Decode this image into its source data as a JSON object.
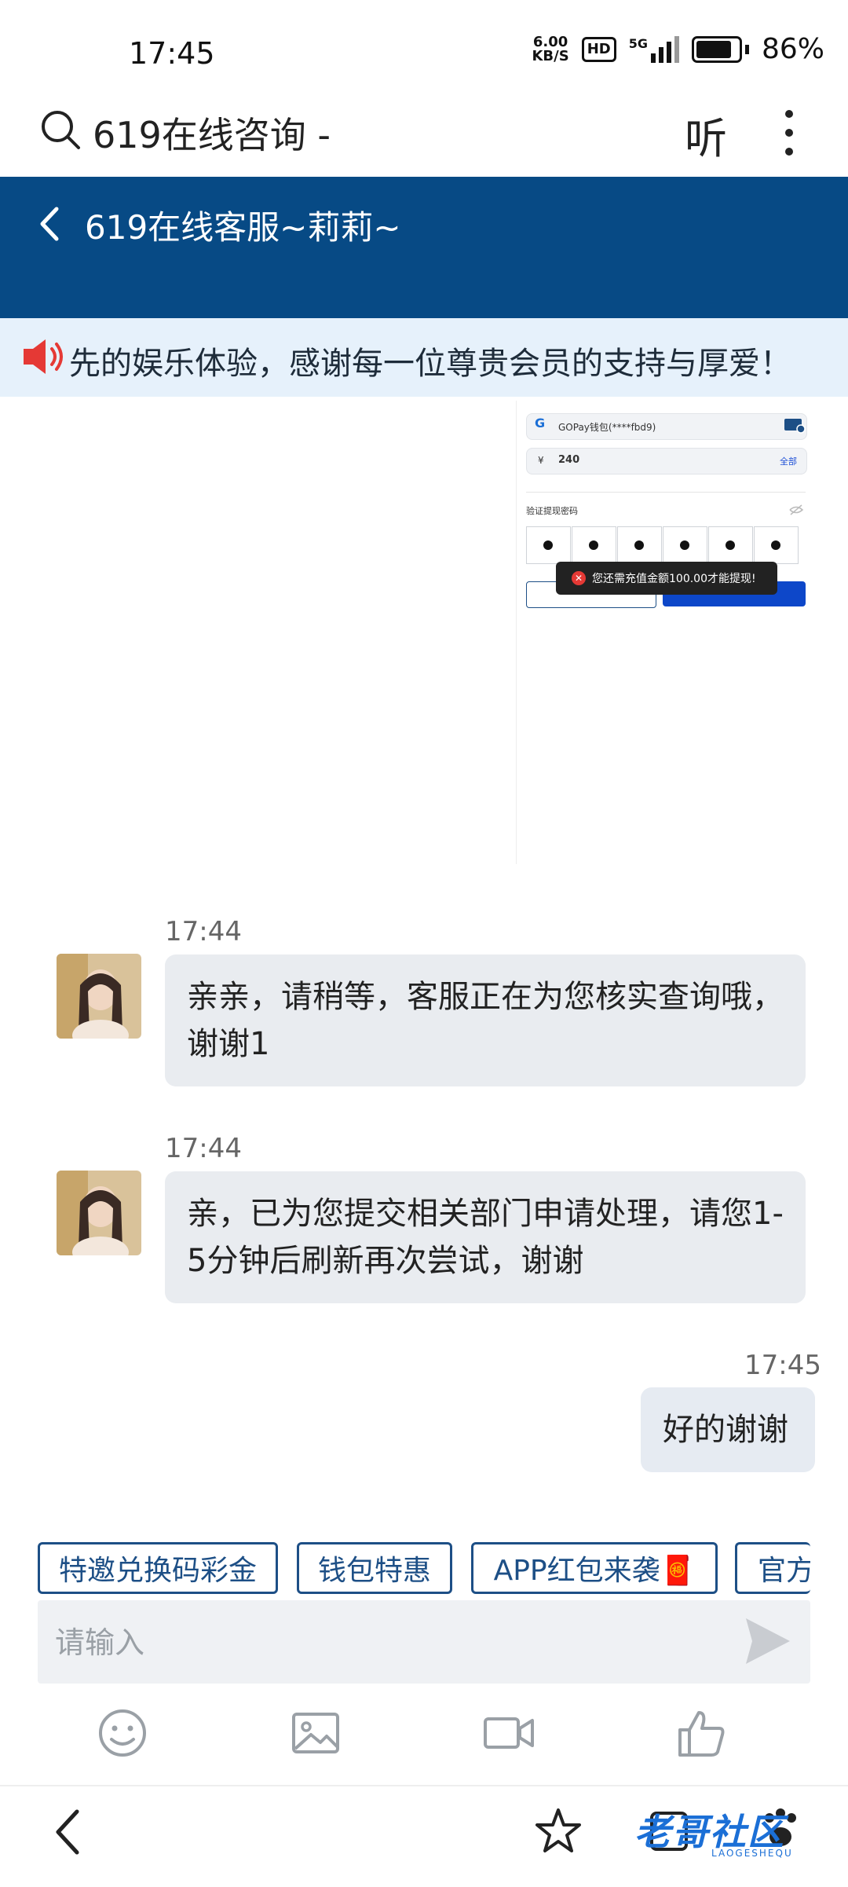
{
  "status_bar": {
    "time": "17:45",
    "net_speed_value": "6.00",
    "net_speed_unit": "KB/S",
    "hd": "HD",
    "network": "5G",
    "battery": "86%"
  },
  "browser": {
    "title": "619在线咨询 -",
    "listen_label": "听"
  },
  "chat": {
    "title": "619在线客服~莉莉~"
  },
  "notice": {
    "text": "先的娱乐体验，感谢每一位尊贵会员的支持与厚爱！"
  },
  "shared_image": {
    "wallet": "GOPay钱包(****fbd9)",
    "currency": "¥",
    "amount": "240",
    "all_label": "全部",
    "password_label": "验证提现密码",
    "toast": "您还需充值金额100.00才能提现!"
  },
  "messages": [
    {
      "time": "17:44",
      "text": "亲亲，请稍等，客服正在为您核实查询哦，谢谢1",
      "from": "agent"
    },
    {
      "time": "17:44",
      "text": "亲，已为您提交相关部门申请处理，请您1-5分钟后刷新再次尝试，谢谢",
      "from": "agent"
    },
    {
      "time": "17:45",
      "text": "好的谢谢",
      "from": "user"
    }
  ],
  "quick_replies": [
    "特邀兑换码彩金",
    "钱包特惠",
    "APP红包来袭🧧",
    "官方"
  ],
  "input": {
    "placeholder": "请输入"
  },
  "watermark": {
    "text": "老哥社区",
    "sub": "LAOGESHEQU"
  },
  "colors": {
    "header": "#074a85",
    "notice_bg": "#e6f1fb",
    "bubble": "#e9ecf0",
    "accent": "#1d4f86"
  }
}
